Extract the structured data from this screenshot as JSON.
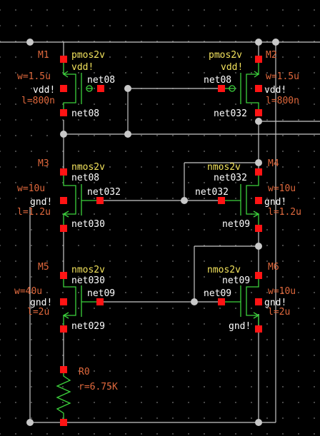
{
  "schematic": {
    "devices": [
      {
        "id": "M1",
        "model": "pmos2v",
        "bulk": "vdd!",
        "w": "w=1.5u",
        "l": "l=800n",
        "gate_net": "net08",
        "drain_net": "net08"
      },
      {
        "id": "M2",
        "model": "pmos2v",
        "bulk": "vdd!",
        "w": "w=1.5u",
        "l": "l=800n",
        "gate_net": "net08",
        "drain_net": "net032"
      },
      {
        "id": "M3",
        "model": "nmos2v",
        "bulk": "gnd!",
        "w": "w=10u",
        "l": "l=1.2u",
        "drain_net": "net08",
        "gate_net": "net032",
        "source_net": "net030"
      },
      {
        "id": "M4",
        "model": "nmos2v",
        "bulk": "gnd!",
        "w": "w=10u",
        "l": "l=1.2u",
        "drain_net": "net032",
        "gate_net": "net032",
        "source_net": "net09"
      },
      {
        "id": "M5",
        "model": "nmos2v",
        "bulk": "gnd!",
        "w": "w=40u",
        "l": "l=2u",
        "drain_net": "net030",
        "gate_net": "net09",
        "source_net": "net029"
      },
      {
        "id": "M6",
        "model": "nmos2v",
        "bulk": "gnd!",
        "w": "w=10u",
        "l": "l=2u",
        "drain_net": "net09",
        "gate_net": "net09",
        "source_net": "gnd!"
      }
    ],
    "resistor": {
      "id": "R0",
      "value": "r=6.75K"
    }
  },
  "colors": {
    "background": "#000000",
    "wire": "#c8c8c8",
    "device": "#3cd23c",
    "pin": "#ff1414",
    "instance_label": "#e0683c",
    "model_label": "#f2e25c",
    "net_label": "#ffffff",
    "grid_dot": "#5a5a5a"
  }
}
